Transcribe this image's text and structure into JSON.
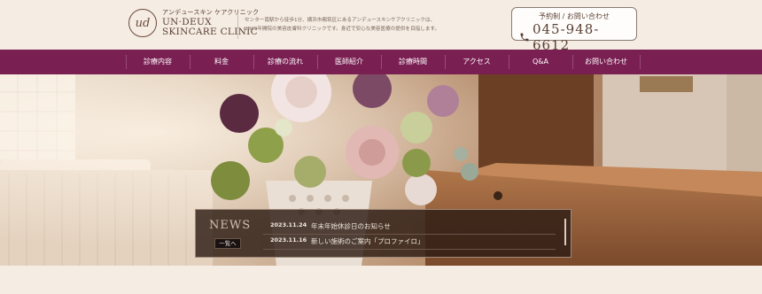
{
  "header": {
    "logo_small": "アンデュースキン ケアクリニック",
    "logo_line1": "UN·DEUX",
    "logo_line2": "SKINCARE CLINIC",
    "logo_mark": "ud",
    "intro_line1": "センター南駅から徒歩1分、横浜市都筑区にあるアンデュースキンケアクリニックは、",
    "intro_line2": "2009年開院の美容皮膚科クリニックです。身近で安心な美容医療の提供を目指します。",
    "phone_label": "予約制 / お問い合わせ",
    "phone_number": "045-948-6612"
  },
  "nav": {
    "items": [
      "診療内容",
      "料金",
      "診療の流れ",
      "医師紹介",
      "診療時間",
      "アクセス",
      "Q&A",
      "お問い合わせ"
    ]
  },
  "news": {
    "title": "NEWS",
    "list_button": "一覧へ",
    "items": [
      {
        "date": "2023.11.24",
        "text": "年末年始休診日のお知らせ"
      },
      {
        "date": "2023.11.16",
        "text": "新しい施術のご案内「プロファイロ」"
      }
    ]
  },
  "colors": {
    "nav_bg": "#7a1f52",
    "page_bg": "#f5ece3",
    "text_brown": "#5a4034"
  }
}
